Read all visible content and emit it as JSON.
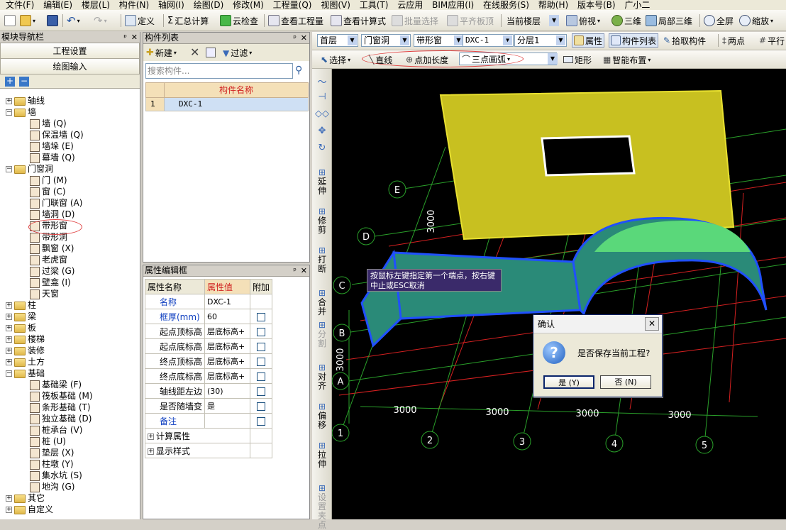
{
  "menu": [
    "文件(F)",
    "编辑(E)",
    "楼层(L)",
    "构件(N)",
    "轴网(I)",
    "绘图(D)",
    "修改(M)",
    "工程量(Q)",
    "视图(V)",
    "工具(T)",
    "云应用",
    "BIM应用(I)",
    "在线服务(S)",
    "帮助(H)",
    "版本号(B)",
    "广小二"
  ],
  "toolbar1": {
    "define": "定义",
    "sum_calc": "汇总计算",
    "cloud_check": "云检查",
    "view_qty": "查看工程量",
    "view_formula": "查看计算式",
    "batch_select": "批量选择",
    "flush_top": "平齐板顶",
    "current_floor": "当前楼层",
    "top_view": "俯视",
    "3d": "三维",
    "local_3d": "局部三维",
    "fullscreen": "全屏",
    "zoom": "缩放",
    "sigma": "Σ"
  },
  "toolbar2": {
    "floor": "首层",
    "category": "门窗洞",
    "type": "带形窗",
    "component": "DXC-1",
    "sublayer": "分层1",
    "property": "属性",
    "comp_list": "构件列表",
    "pick": "拾取构件",
    "two_point": "两点",
    "parallel": "平行"
  },
  "toolbar3": {
    "select": "选择",
    "line": "直线",
    "point_len": "点加长度",
    "three_arc": "三点画弧",
    "rect": "矩形",
    "smart": "智能布置"
  },
  "nav": {
    "title": "模块导航栏",
    "project_settings": "工程设置",
    "draw_input": "绘图输入",
    "tree": [
      {
        "label": "轴线",
        "level": 0,
        "exp": "+"
      },
      {
        "label": "墙",
        "level": 0,
        "exp": "-"
      },
      {
        "label": "墙 (Q)",
        "level": 1
      },
      {
        "label": "保温墙 (Q)",
        "level": 1
      },
      {
        "label": "墙垛 (E)",
        "level": 1
      },
      {
        "label": "幕墙 (Q)",
        "level": 1
      },
      {
        "label": "门窗洞",
        "level": 0,
        "exp": "-"
      },
      {
        "label": "门 (M)",
        "level": 1
      },
      {
        "label": "窗 (C)",
        "level": 1
      },
      {
        "label": "门联窗 (A)",
        "level": 1
      },
      {
        "label": "墙洞 (D)",
        "level": 1
      },
      {
        "label": "带形窗",
        "level": 1
      },
      {
        "label": "带形洞",
        "level": 1
      },
      {
        "label": "飘窗 (X)",
        "level": 1
      },
      {
        "label": "老虎窗",
        "level": 1
      },
      {
        "label": "过梁 (G)",
        "level": 1
      },
      {
        "label": "壁龛 (I)",
        "level": 1
      },
      {
        "label": "天窗",
        "level": 1
      },
      {
        "label": "柱",
        "level": 0,
        "exp": "+"
      },
      {
        "label": "梁",
        "level": 0,
        "exp": "+"
      },
      {
        "label": "板",
        "level": 0,
        "exp": "+"
      },
      {
        "label": "楼梯",
        "level": 0,
        "exp": "+"
      },
      {
        "label": "装修",
        "level": 0,
        "exp": "+"
      },
      {
        "label": "土方",
        "level": 0,
        "exp": "+"
      },
      {
        "label": "基础",
        "level": 0,
        "exp": "-"
      },
      {
        "label": "基础梁 (F)",
        "level": 1
      },
      {
        "label": "筏板基础 (M)",
        "level": 1
      },
      {
        "label": "条形基础 (T)",
        "level": 1
      },
      {
        "label": "独立基础 (D)",
        "level": 1
      },
      {
        "label": "桩承台 (V)",
        "level": 1
      },
      {
        "label": "桩 (U)",
        "level": 1
      },
      {
        "label": "垫层 (X)",
        "level": 1
      },
      {
        "label": "柱墩 (Y)",
        "level": 1
      },
      {
        "label": "集水坑 (S)",
        "level": 1
      },
      {
        "label": "地沟 (G)",
        "level": 1
      },
      {
        "label": "其它",
        "level": 0,
        "exp": "+"
      },
      {
        "label": "自定义",
        "level": 0,
        "exp": "+"
      }
    ]
  },
  "comp_list": {
    "title": "构件列表",
    "new": "新建",
    "filter": "过滤",
    "search_placeholder": "搜索构件...",
    "col_name": "构件名称",
    "rows": [
      {
        "idx": "1",
        "name": "DXC-1"
      }
    ]
  },
  "props": {
    "title": "属性编辑框",
    "col_name": "属性名称",
    "col_value": "属性值",
    "col_extra": "附加",
    "rows": [
      {
        "name": "名称",
        "value": "DXC-1",
        "blue": true,
        "cb": false
      },
      {
        "name": "框厚(mm)",
        "value": "60",
        "blue": true,
        "cb": true
      },
      {
        "name": "起点顶标高",
        "value": "层底标高+",
        "blue": false,
        "cb": true
      },
      {
        "name": "起点底标高",
        "value": "层底标高+",
        "blue": false,
        "cb": true
      },
      {
        "name": "终点顶标高",
        "value": "层底标高+",
        "blue": false,
        "cb": true
      },
      {
        "name": "终点底标高",
        "value": "层底标高+",
        "blue": false,
        "cb": true
      },
      {
        "name": "轴线距左边",
        "value": "(30)",
        "blue": false,
        "cb": true
      },
      {
        "name": "是否随墙变",
        "value": "是",
        "blue": false,
        "cb": true
      },
      {
        "name": "备注",
        "value": "",
        "blue": true,
        "cb": true
      }
    ],
    "calc_props": "计算属性",
    "display_style": "显示样式"
  },
  "vtools": [
    "延伸",
    "修剪",
    "打断",
    "合并",
    "分割",
    "对齐",
    "偏移",
    "拉伸",
    "设置夹点"
  ],
  "canvas": {
    "axis_letters": [
      "E",
      "D",
      "C",
      "B",
      "A"
    ],
    "axis_numbers": [
      "1",
      "2",
      "3",
      "4",
      "5"
    ],
    "dim_3000": "3000",
    "tooltip": "按鼠标左键指定第一个端点，按右键中止或ESC取消"
  },
  "dialog": {
    "title": "确认",
    "message": "是否保存当前工程?",
    "yes": "是 (Y)",
    "no": "否 (N)",
    "close": "✕"
  }
}
